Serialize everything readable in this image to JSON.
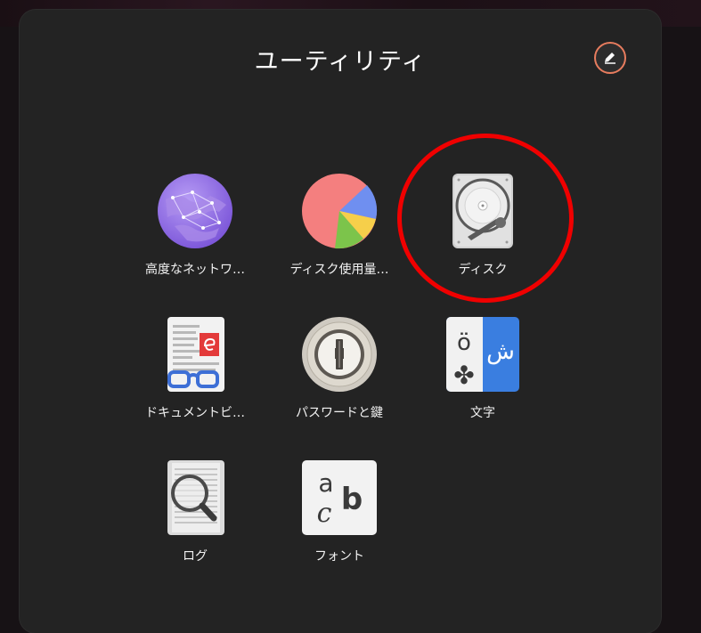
{
  "folder": {
    "title": "ユーティリティ",
    "rename_button_icon": "pencil-icon"
  },
  "apps": [
    {
      "id": "network",
      "label": "高度なネットワ…",
      "icon": "network-globe-icon"
    },
    {
      "id": "disk-usage",
      "label": "ディスク使用量…",
      "icon": "pie-chart-icon"
    },
    {
      "id": "disks",
      "label": "ディスク",
      "icon": "hard-disk-icon"
    },
    {
      "id": "document-viewer",
      "label": "ドキュメントビ…",
      "icon": "document-glasses-icon"
    },
    {
      "id": "passwords",
      "label": "パスワードと鍵",
      "icon": "keyhole-icon"
    },
    {
      "id": "characters",
      "label": "文字",
      "icon": "characters-icon"
    },
    {
      "id": "logs",
      "label": "ログ",
      "icon": "log-magnifier-icon"
    },
    {
      "id": "fonts",
      "label": "フォント",
      "icon": "font-icon"
    }
  ],
  "glyphs": {
    "characters_left": "ö",
    "characters_right": "ش",
    "characters_suit": "✤",
    "font_a": "a",
    "font_b": "b",
    "font_c": "c"
  },
  "colors": {
    "highlight_ring": "#f00000",
    "rename_ring": "#e77c5e",
    "folder_bg": "#232323"
  }
}
